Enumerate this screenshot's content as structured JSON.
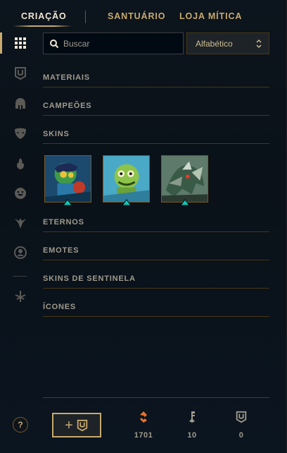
{
  "topnav": {
    "tabs": [
      {
        "label": "CRIAÇÃO",
        "active": true
      },
      {
        "label": "SANTUÁRIO",
        "active": false
      },
      {
        "label": "LOJA MÍTICA",
        "active": false
      }
    ]
  },
  "sidebar": {
    "items": [
      {
        "icon": "grid-icon",
        "active": true
      },
      {
        "icon": "materials-icon",
        "active": false
      },
      {
        "icon": "champion-helmet-icon",
        "active": false
      },
      {
        "icon": "skin-mask-icon",
        "active": false
      },
      {
        "icon": "ward-flame-icon",
        "active": false
      },
      {
        "icon": "emote-face-icon",
        "active": false
      },
      {
        "icon": "eternals-icon",
        "active": false
      },
      {
        "icon": "profile-icon",
        "active": false
      },
      {
        "icon": "disenchant-icon",
        "active": false
      }
    ]
  },
  "search": {
    "placeholder": "Buscar",
    "value": ""
  },
  "sort": {
    "selected": "Alfabético"
  },
  "categories": {
    "materiais": "MATERIAIS",
    "campeoes": "CAMPEÕES",
    "skins": "SKINS",
    "eternos": "ETERNOS",
    "emotes": "EMOTES",
    "skins_sentinela": "SKINS DE SENTINELA",
    "icones": "ÍCONES"
  },
  "skins": [
    {
      "name": "skin-shard-1"
    },
    {
      "name": "skin-shard-2"
    },
    {
      "name": "skin-shard-3"
    }
  ],
  "footer": {
    "help_label": "?",
    "add_label": "+",
    "currencies": [
      {
        "icon": "orange-essence-icon",
        "value": "1701"
      },
      {
        "icon": "key-fragment-icon",
        "value": "10"
      },
      {
        "icon": "chest-icon",
        "value": "0"
      }
    ]
  },
  "colors": {
    "gold": "#c8aa6e",
    "accent_blue": "#0ac8b9",
    "essence_orange": "#e8732c"
  }
}
